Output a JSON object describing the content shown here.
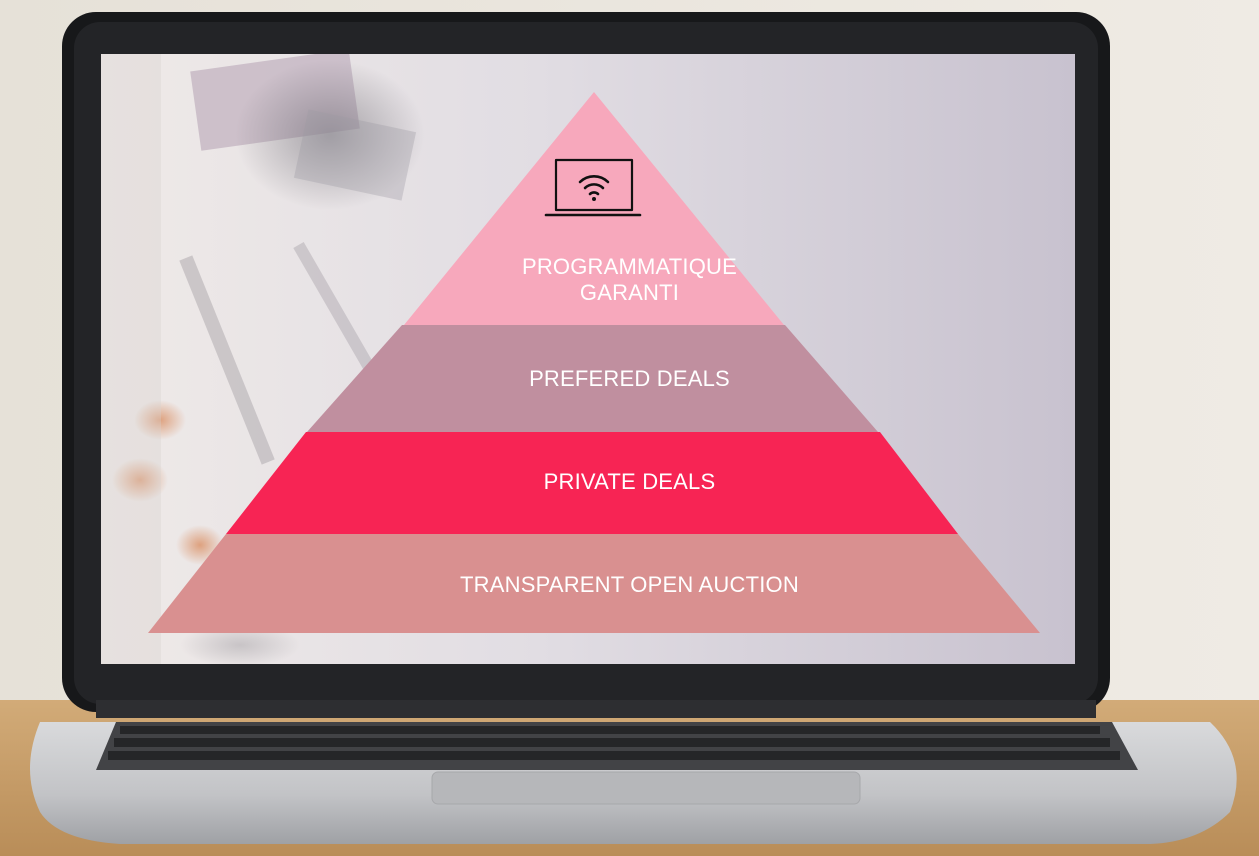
{
  "pyramid": {
    "tiers": [
      {
        "label_lines": [
          "PROGRAMMATIQUE",
          "GARANTI"
        ],
        "color": "#f7a8bc"
      },
      {
        "label_lines": [
          "PREFERED DEALS"
        ],
        "color": "#c08f9f"
      },
      {
        "label_lines": [
          "PRIVATE DEALS"
        ],
        "color": "#f72454"
      },
      {
        "label_lines": [
          "TRANSPARENT OPEN AUCTION"
        ],
        "color": "#d99090"
      }
    ],
    "top_icon": "laptop-wifi-icon"
  },
  "colors": {
    "bezel": "#1b1c1e",
    "screen_bg": "#dcd8de",
    "laptop_body": "#c9cacc",
    "desk": "#c8a06d",
    "wall": "#ebe5dc"
  }
}
